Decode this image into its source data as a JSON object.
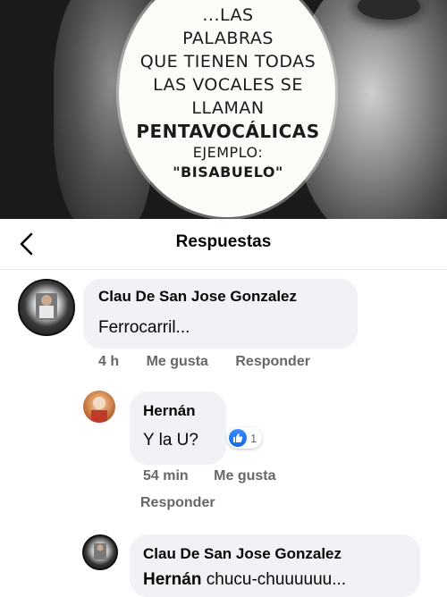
{
  "meme": {
    "lines": [
      "...LAS",
      "PALABRAS",
      "QUE TIENEN TODAS",
      "LAS VOCALES SE",
      "LLAMAN"
    ],
    "highlight": "PENTAVOCÁLICAS",
    "example_label": "EJEMPLO:",
    "example_word": "\"BISABUELO\""
  },
  "header": {
    "title": "Respuestas"
  },
  "comments": [
    {
      "author": "Clau De San Jose Gonzalez",
      "text": "Ferrocarril...",
      "time": "4 h",
      "like_label": "Me gusta",
      "reply_label": "Responder"
    },
    {
      "author": "Hernán",
      "text": "Y la U?",
      "reaction_count": "1",
      "time": "54 min",
      "like_label": "Me gusta",
      "reply_label": "Responder"
    },
    {
      "author": "Clau De San Jose Gonzalez",
      "mention": "Hernán",
      "text": "chucu-chuuuuuu..."
    }
  ],
  "colors": {
    "bubble": "#f0f2f5",
    "meta": "#65676b",
    "like_blue": "#1877f2"
  }
}
